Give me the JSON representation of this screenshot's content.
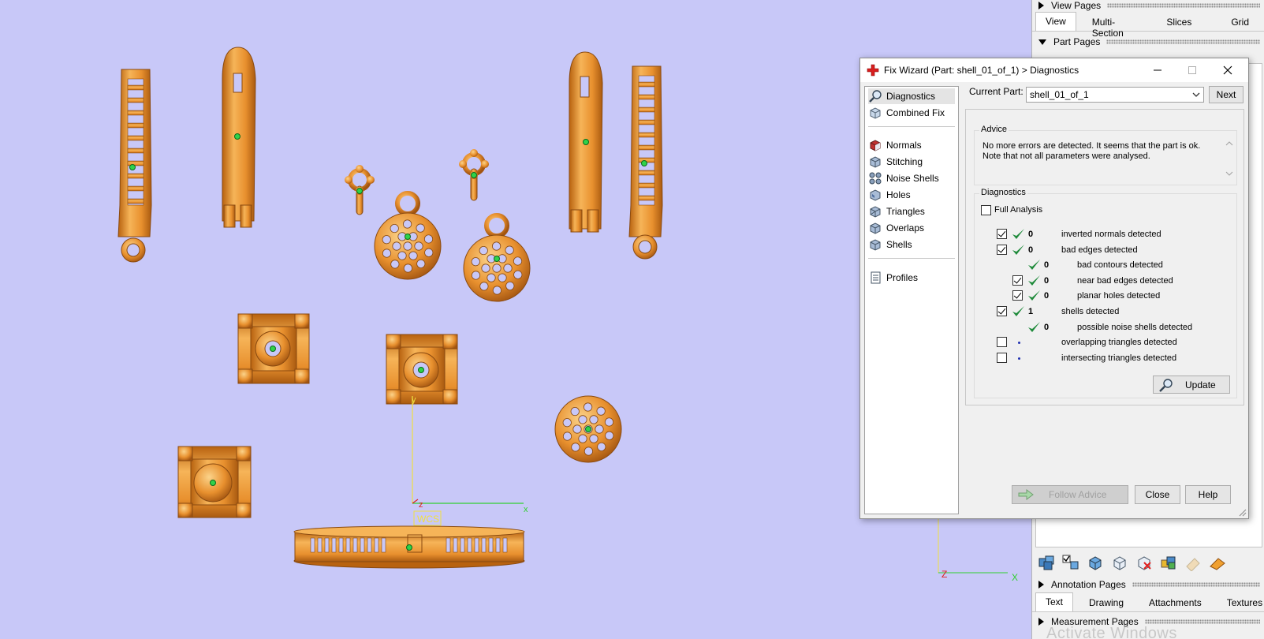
{
  "viewport": {
    "wcs_label": "WCS",
    "axis_y": "y",
    "axis_z": "z",
    "axis_x": "x",
    "axis2_z": "Z",
    "axis2_x": "X",
    "model_color": "#f0a040",
    "background_color": "#c8c8f8"
  },
  "side_panel": {
    "view_pages": {
      "label": "View Pages",
      "tabs": [
        {
          "label": "View",
          "active": true
        },
        {
          "label": "Multi-Section",
          "active": false
        },
        {
          "label": "Slices",
          "active": false
        },
        {
          "label": "Grid",
          "active": false
        }
      ]
    },
    "part_pages": {
      "label": "Part Pages"
    },
    "annotation_pages": {
      "label": "Annotation Pages",
      "tabs": [
        {
          "label": "Text",
          "active": true
        },
        {
          "label": "Drawing",
          "active": false
        },
        {
          "label": "Attachments",
          "active": false
        },
        {
          "label": "Textures",
          "active": false
        }
      ]
    },
    "measurement_pages": {
      "label": "Measurement Pages"
    },
    "watermark": "Activate Windows"
  },
  "dialog": {
    "title": "Fix Wizard (Part: shell_01_of_1) > Diagnostics",
    "nav_group1": [
      {
        "label": "Diagnostics",
        "icon": "magnifier-icon",
        "selected": true
      },
      {
        "label": "Combined Fix",
        "icon": "cube-icon",
        "selected": false
      }
    ],
    "nav_group2": [
      {
        "label": "Normals",
        "icon": "normals-cube-icon"
      },
      {
        "label": "Stitching",
        "icon": "stitching-cube-icon"
      },
      {
        "label": "Noise Shells",
        "icon": "noise-shells-icon"
      },
      {
        "label": "Holes",
        "icon": "holes-cube-icon"
      },
      {
        "label": "Triangles",
        "icon": "triangles-cube-icon"
      },
      {
        "label": "Overlaps",
        "icon": "overlaps-cube-icon"
      },
      {
        "label": "Shells",
        "icon": "shells-cube-icon"
      }
    ],
    "nav_group3": [
      {
        "label": "Profiles",
        "icon": "profiles-document-icon"
      }
    ],
    "current_part_label": "Current Part:",
    "current_part_value": "shell_01_of_1",
    "next_label": "Next",
    "advice": {
      "title": "Advice",
      "text": "No more errors are detected. It seems that the part is ok. Note that not all parameters were analysed."
    },
    "diagnostics": {
      "title": "Diagnostics",
      "full_analysis_label": "Full Analysis",
      "rows": [
        {
          "checkbox": true,
          "checked": true,
          "status": "ok",
          "count": "0",
          "label": "inverted normals detected",
          "indent": 0
        },
        {
          "checkbox": true,
          "checked": true,
          "status": "ok",
          "count": "0",
          "label": "bad edges detected",
          "indent": 0
        },
        {
          "checkbox": false,
          "checked": false,
          "status": "ok",
          "count": "0",
          "label": "bad contours detected",
          "indent": 1
        },
        {
          "checkbox": true,
          "checked": true,
          "status": "ok",
          "count": "0",
          "label": "near bad edges detected",
          "indent": 1
        },
        {
          "checkbox": true,
          "checked": true,
          "status": "ok",
          "count": "0",
          "label": "planar holes detected",
          "indent": 1
        },
        {
          "checkbox": true,
          "checked": true,
          "status": "ok",
          "count": "1",
          "label": "shells detected",
          "indent": 0
        },
        {
          "checkbox": false,
          "checked": false,
          "status": "ok",
          "count": "0",
          "label": "possible noise shells detected",
          "indent": 1
        },
        {
          "checkbox": true,
          "checked": false,
          "status": "none",
          "count": "",
          "label": "overlapping triangles detected",
          "indent": 0
        },
        {
          "checkbox": true,
          "checked": false,
          "status": "none",
          "count": "",
          "label": "intersecting triangles detected",
          "indent": 0
        }
      ],
      "update_label": "Update"
    },
    "follow_advice_label": "Follow Advice",
    "close_label": "Close",
    "help_label": "Help"
  }
}
